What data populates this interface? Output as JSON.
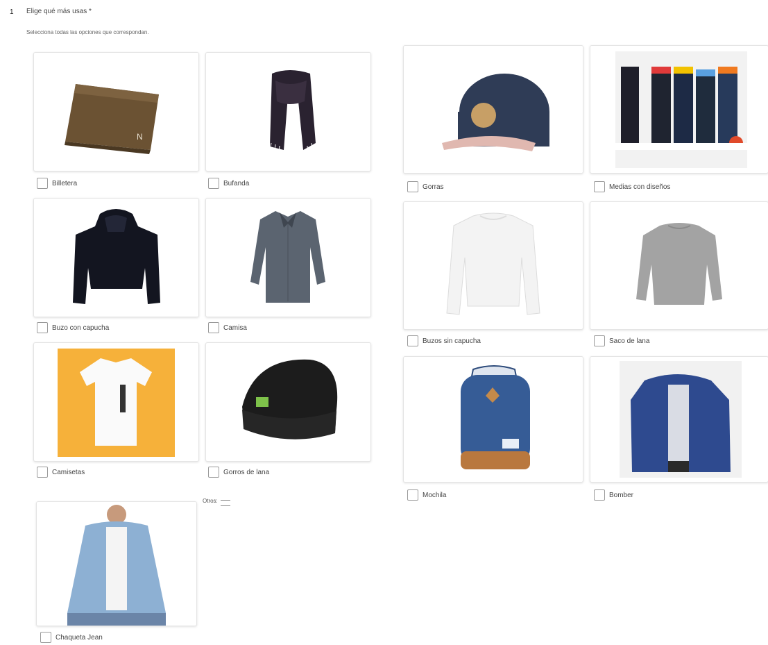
{
  "question": {
    "number": "1",
    "title": "Elige qué más usas *",
    "subtitle": "Selecciona todas las opciones que correspondan."
  },
  "options": [
    {
      "label": "Billetera",
      "icon": "wallet-image"
    },
    {
      "label": "Bufanda",
      "icon": "scarf-image"
    },
    {
      "label": "Gorras",
      "icon": "cap-image"
    },
    {
      "label": "Medias con diseños",
      "icon": "socks-image"
    },
    {
      "label": "Buzo con capucha",
      "icon": "hoodie-image"
    },
    {
      "label": "Camisa",
      "icon": "shirt-image"
    },
    {
      "label": "Buzos sin capucha",
      "icon": "sweatshirt-image"
    },
    {
      "label": "Saco de lana",
      "icon": "wool-sweater-image"
    },
    {
      "label": "Camisetas",
      "icon": "tshirt-image"
    },
    {
      "label": "Gorros de lana",
      "icon": "beanie-image"
    },
    {
      "label": "Mochila",
      "icon": "backpack-image"
    },
    {
      "label": "Bomber",
      "icon": "bomber-jacket-image"
    },
    {
      "label": "Chaqueta Jean",
      "icon": "denim-jacket-image"
    }
  ],
  "other": {
    "label": "Otros:"
  }
}
